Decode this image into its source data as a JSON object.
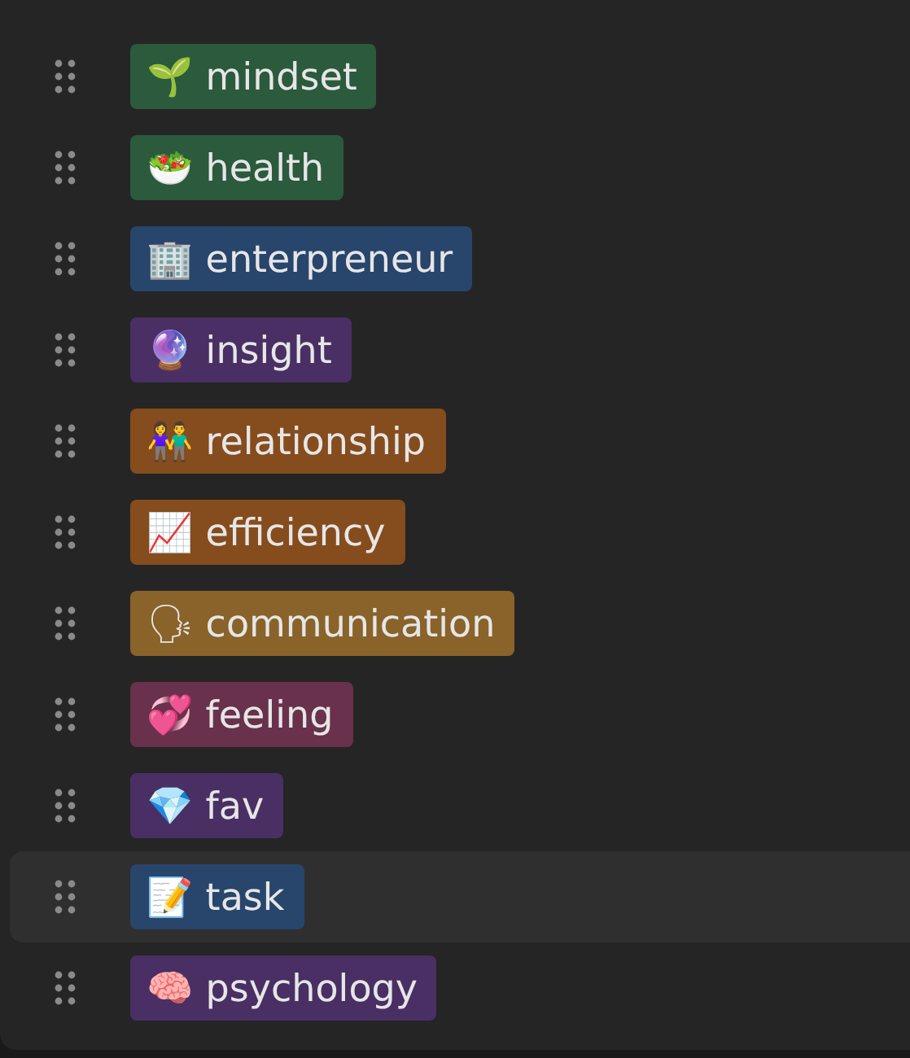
{
  "tags": [
    {
      "label": "🌱 mindset",
      "color": "#2b5a3d",
      "highlighted": false
    },
    {
      "label": "🥗 health",
      "color": "#2b5a3d",
      "highlighted": false
    },
    {
      "label": "🏢 enterpreneur",
      "color": "#28456c",
      "highlighted": false
    },
    {
      "label": "🔮 insight",
      "color": "#492f64",
      "highlighted": false
    },
    {
      "label": "👫 relationship",
      "color": "#854c1d",
      "highlighted": false
    },
    {
      "label": "📈 efficiency",
      "color": "#854c1d",
      "highlighted": false
    },
    {
      "label": "🗣 communication",
      "color": "#89632a",
      "highlighted": false
    },
    {
      "label": "💞 feeling",
      "color": "#69314c",
      "highlighted": false
    },
    {
      "label": "💎 fav",
      "color": "#492f64",
      "highlighted": false
    },
    {
      "label": "📝 task",
      "color": "#28456c",
      "highlighted": true
    },
    {
      "label": "🧠 psychology",
      "color": "#492f64",
      "highlighted": false
    }
  ]
}
